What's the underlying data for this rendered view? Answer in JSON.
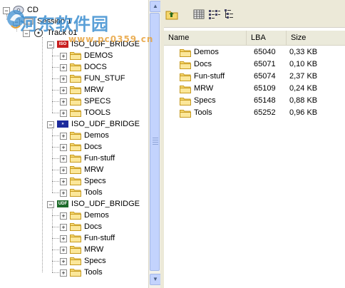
{
  "tree": {
    "cd_label": "CD",
    "session_label": "Session 1",
    "track_label": "Track 01",
    "volumes": [
      {
        "label": "ISO_UDF_BRIDGE",
        "badge": "ISO",
        "badge_color": "#c81e1e",
        "children": [
          "DEMOS",
          "DOCS",
          "FUN_STUF",
          "MRW",
          "SPECS",
          "TOOLS"
        ]
      },
      {
        "label": "ISO_UDF_BRIDGE",
        "badge": "»",
        "badge_color": "#1c2a9c",
        "children": [
          "Demos",
          "Docs",
          "Fun-stuff",
          "MRW",
          "Specs",
          "Tools"
        ]
      },
      {
        "label": "ISO_UDF_BRIDGE",
        "badge": "UDF",
        "badge_color": "#1d6b2a",
        "children": [
          "Demos",
          "Docs",
          "Fun-stuff",
          "MRW",
          "Specs",
          "Tools"
        ]
      }
    ]
  },
  "list": {
    "columns": [
      "Name",
      "LBA",
      "Size"
    ],
    "rows": [
      {
        "name": "Demos",
        "lba": "65040",
        "size": "0,33 KB"
      },
      {
        "name": "Docs",
        "lba": "65071",
        "size": "0,10 KB"
      },
      {
        "name": "Fun-stuff",
        "lba": "65074",
        "size": "2,37 KB"
      },
      {
        "name": "MRW",
        "lba": "65109",
        "size": "0,24 KB"
      },
      {
        "name": "Specs",
        "lba": "65148",
        "size": "0,88 KB"
      },
      {
        "name": "Tools",
        "lba": "65252",
        "size": "0,96 KB"
      }
    ]
  },
  "toolbar": {
    "icons": [
      "folder-up-icon",
      "large-icons-view-icon",
      "list-view-icon",
      "details-view-icon"
    ]
  },
  "watermark": {
    "title": "河东软件园",
    "url": "www.pc0359.cn"
  },
  "colors": {
    "folder": "#f5d76e",
    "folder_edge": "#c79a1e",
    "toolbar_bg": "#ece9d8",
    "header_bg": "#ebeadb",
    "scroll_thumb": "#c3d3fd"
  }
}
